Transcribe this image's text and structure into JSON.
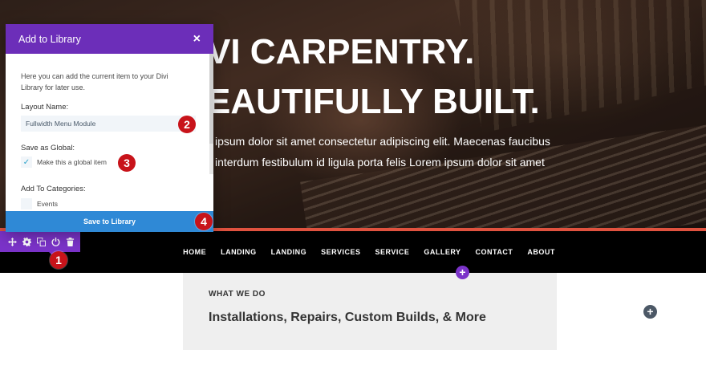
{
  "hero": {
    "title_line1": "VI CARPENTRY.",
    "title_line2": "EAUTIFULLY BUILT.",
    "body_line1": "ipsum dolor sit amet consectetur adipiscing elit. Maecenas faucibus",
    "body_line2": "interdum festibulum id ligula porta felis Lorem ipsum dolor sit amet"
  },
  "nav": {
    "items": [
      "HOME",
      "LANDING",
      "LANDING",
      "SERVICES",
      "SERVICE",
      "GALLERY",
      "CONTACT",
      "ABOUT"
    ]
  },
  "module_toolbar": {
    "icons": [
      "move-icon",
      "settings-icon",
      "duplicate-icon",
      "save-to-library-icon",
      "trash-icon"
    ]
  },
  "section": {
    "eyebrow": "WHAT WE DO",
    "headline": "Installations, Repairs, Custom Builds, & More",
    "add_symbol": "+"
  },
  "modal": {
    "title": "Add to Library",
    "close_symbol": "×",
    "description": "Here you can add the current item to your Divi Library for later use.",
    "layout_name_label": "Layout Name:",
    "layout_name_value": "Fullwidth Menu Module",
    "save_as_global_label": "Save as Global:",
    "global_checkbox_label": "Make this a global item",
    "global_checked": true,
    "categories_label": "Add To Categories:",
    "category_item": "Events",
    "save_button": "Save to Library"
  },
  "badges": [
    "1",
    "2",
    "3",
    "4"
  ],
  "colors": {
    "purple": "#7b33c9",
    "modal_header": "#6c2eb9",
    "save_button": "#2f89d6",
    "badge_red": "#c8131a",
    "accent_line": "#e0523f"
  }
}
